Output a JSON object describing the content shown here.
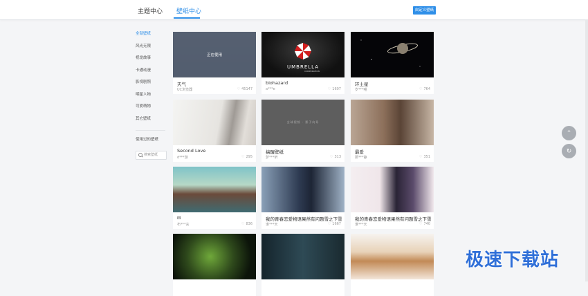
{
  "nav": {
    "tab_theme": "主题中心",
    "tab_wallpaper": "壁纸中心",
    "custom_button": "自定义壁纸"
  },
  "sidebar": {
    "categories": [
      "全部壁纸",
      "风光无限",
      "视觉故事",
      "卡通动漫",
      "影视剧照",
      "明星人物",
      "可爱萌物",
      "其它壁纸"
    ],
    "history": "使用过的壁纸",
    "search_placeholder": "搜索壁纸"
  },
  "cards": [
    {
      "title": "天气",
      "author": "UC浏览器",
      "likes": "45147",
      "overlay": "正在使用"
    },
    {
      "title": "biohazard",
      "author": "a***e",
      "likes": "1607",
      "logo_top": "UMBRELLA",
      "logo_bottom": "CORPORATION"
    },
    {
      "title": "环土星",
      "author": "岁***喵",
      "likes": "764"
    },
    {
      "title": "Second Love",
      "author": "d***游",
      "likes": "295"
    },
    {
      "title": "搞醒壁纸",
      "author": "梦***昕",
      "likes": "313",
      "thumb_text": "全球视频 · 影子向导"
    },
    {
      "title": "最爱",
      "author": "那***静",
      "likes": "351"
    },
    {
      "title": "⊟",
      "author": "布***言",
      "likes": "836"
    },
    {
      "title": "我的青春恋爱物语果然有问题雪之下雪",
      "author": "谁***天",
      "likes": "1667"
    },
    {
      "title": "我的青春恋爱物语果然有问题雪之下雪",
      "author": "谁***天",
      "likes": "740"
    },
    {
      "title": "",
      "author": "",
      "likes": ""
    },
    {
      "title": "",
      "author": "",
      "likes": ""
    },
    {
      "title": "",
      "author": "",
      "likes": ""
    }
  ],
  "float_buttons": {
    "up_icon": "chevron-up-icon",
    "refresh_icon": "refresh-icon"
  },
  "watermark": "极速下载站",
  "colors": {
    "accent": "#2f8fe8",
    "overlay": "#505c6e"
  }
}
